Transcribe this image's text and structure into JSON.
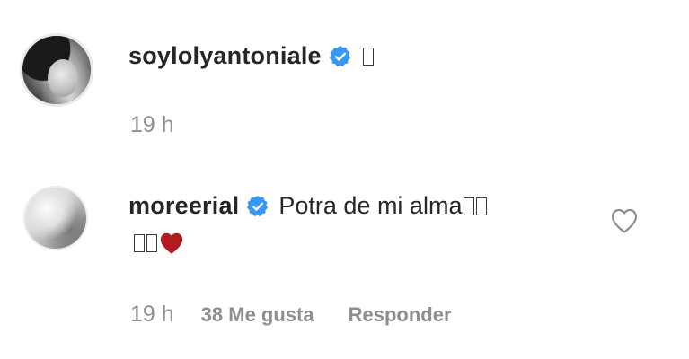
{
  "comments": [
    {
      "username": "soylolyantoniale",
      "text": "",
      "time": "19 h"
    },
    {
      "username": "moreerial",
      "text": "Potra de mi alma",
      "time": "19 h",
      "likes": "38 Me gusta",
      "reply_label": "Responder"
    }
  ],
  "icons": {
    "verified": "verified-badge-icon",
    "heart_emoji": "red-heart-icon",
    "like": "heart-outline-icon"
  },
  "colors": {
    "verified_blue": "#3897f0",
    "heart_red": "#b11a1e",
    "meta_gray": "#8e8e8e",
    "text_dark": "#262626"
  }
}
